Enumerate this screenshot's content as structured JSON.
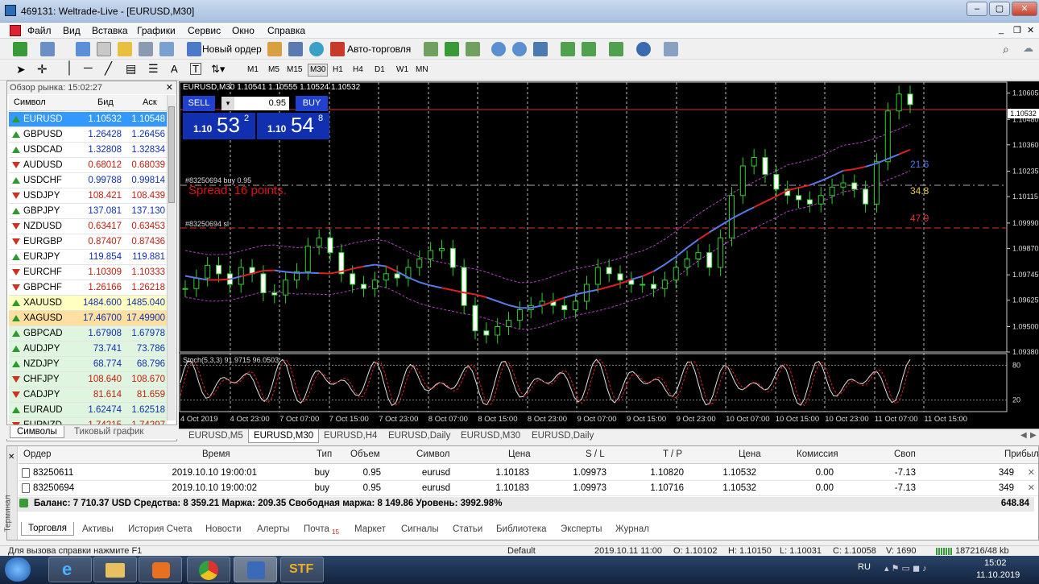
{
  "window": {
    "title": "469131: Weltrade-Live - [EURUSD,M30]"
  },
  "menu": [
    "Файл",
    "Вид",
    "Вставка",
    "Графики",
    "Сервис",
    "Окно",
    "Справка"
  ],
  "toolbar": {
    "new_order": "Новый ордер",
    "autotrading": "Авто-торговля"
  },
  "timeframes": [
    "M1",
    "M5",
    "M15",
    "M30",
    "H1",
    "H4",
    "D1",
    "W1",
    "MN"
  ],
  "active_timeframe": "M30",
  "market_watch": {
    "header": "Обзор рынка: 15:02:27",
    "col_symbol": "Символ",
    "col_bid": "Бид",
    "col_ask": "Аск",
    "rows": [
      {
        "symbol": "EURUSD",
        "bid": "1.10532",
        "ask": "1.10548",
        "dir": "up",
        "selected": true
      },
      {
        "symbol": "GBPUSD",
        "bid": "1.26428",
        "ask": "1.26456",
        "dir": "up"
      },
      {
        "symbol": "USDCAD",
        "bid": "1.32808",
        "ask": "1.32834",
        "dir": "up"
      },
      {
        "symbol": "AUDUSD",
        "bid": "0.68012",
        "ask": "0.68039",
        "dir": "down"
      },
      {
        "symbol": "USDCHF",
        "bid": "0.99788",
        "ask": "0.99814",
        "dir": "up"
      },
      {
        "symbol": "USDJPY",
        "bid": "108.421",
        "ask": "108.439",
        "dir": "down"
      },
      {
        "symbol": "GBPJPY",
        "bid": "137.081",
        "ask": "137.130",
        "dir": "up"
      },
      {
        "symbol": "NZDUSD",
        "bid": "0.63417",
        "ask": "0.63453",
        "dir": "down"
      },
      {
        "symbol": "EURGBP",
        "bid": "0.87407",
        "ask": "0.87436",
        "dir": "down"
      },
      {
        "symbol": "EURJPY",
        "bid": "119.854",
        "ask": "119.881",
        "dir": "up"
      },
      {
        "symbol": "EURCHF",
        "bid": "1.10309",
        "ask": "1.10333",
        "dir": "down"
      },
      {
        "symbol": "GBPCHF",
        "bid": "1.26166",
        "ask": "1.26218",
        "dir": "down"
      },
      {
        "symbol": "XAUUSD",
        "bid": "1484.600",
        "ask": "1485.040",
        "dir": "up",
        "highlight": "#ffffc0"
      },
      {
        "symbol": "XAGUSD",
        "bid": "17.46700",
        "ask": "17.49900",
        "dir": "up",
        "highlight": "#ffe0a0"
      },
      {
        "symbol": "GBPCAD",
        "bid": "1.67908",
        "ask": "1.67978",
        "dir": "up",
        "highlight": "#dff5df"
      },
      {
        "symbol": "AUDJPY",
        "bid": "73.741",
        "ask": "73.786",
        "dir": "up",
        "highlight": "#dff5df"
      },
      {
        "symbol": "NZDJPY",
        "bid": "68.774",
        "ask": "68.796",
        "dir": "up",
        "highlight": "#dff5df"
      },
      {
        "symbol": "CHFJPY",
        "bid": "108.640",
        "ask": "108.670",
        "dir": "down",
        "highlight": "#dff5df"
      },
      {
        "symbol": "CADJPY",
        "bid": "81.614",
        "ask": "81.659",
        "dir": "down",
        "highlight": "#dff5df"
      },
      {
        "symbol": "EURAUD",
        "bid": "1.62474",
        "ask": "1.62518",
        "dir": "up",
        "highlight": "#dff5df"
      },
      {
        "symbol": "EURNZD",
        "bid": "1.74215",
        "ask": "1.74297",
        "dir": "down",
        "highlight": "#dff5df"
      }
    ],
    "tabs": [
      "Символы",
      "Тиковый график"
    ]
  },
  "chart": {
    "header": "EURUSD,M30  1.10541 1.10555 1.10524 1.10532",
    "sell": "SELL",
    "buy": "BUY",
    "lot": "0.95",
    "sell_prefix": "1.10",
    "sell_big": "53",
    "sell_sup": "2",
    "buy_prefix": "1.10",
    "buy_big": "54",
    "buy_sup": "8",
    "order_buy_label": "#83250694 buy 0.95",
    "order_sl_label": "#83250694 sl",
    "spread": "Spread: 16 points.",
    "levels": {
      "a": "21.6",
      "b": "34.8",
      "c": "47.9"
    },
    "stoch_label": "Stoch(5,3,3) 91.9715 96.0503",
    "current_price": "1.10532"
  },
  "chart_data": {
    "type": "line",
    "title": "EURUSD,M30",
    "y_ticks": [
      "1.10605",
      "1.10480",
      "1.10360",
      "1.10235",
      "1.10115",
      "1.09990",
      "1.09870",
      "1.09745",
      "1.09625",
      "1.09500",
      "1.09380"
    ],
    "x_ticks": [
      "4 Oct 2019",
      "4 Oct 23:00",
      "7 Oct 07:00",
      "7 Oct 15:00",
      "7 Oct 23:00",
      "8 Oct 07:00",
      "8 Oct 15:00",
      "8 Oct 23:00",
      "9 Oct 07:00",
      "9 Oct 15:00",
      "9 Oct 23:00",
      "10 Oct 07:00",
      "10 Oct 15:00",
      "10 Oct 23:00",
      "11 Oct 07:00",
      "11 Oct 15:00"
    ],
    "ylim": [
      1.0938,
      1.1066
    ],
    "series": [
      {
        "values": [
          1.0968,
          1.0973,
          1.0979,
          1.0975,
          1.097,
          1.0978,
          1.0975,
          1.0966,
          1.0965,
          1.0972,
          1.0976,
          1.0988,
          1.0992,
          1.0985,
          1.0975,
          1.097,
          1.0968,
          1.0972,
          1.0975,
          1.0973,
          1.0978,
          1.0982,
          1.0986,
          1.0987,
          1.0978,
          1.096,
          1.0948,
          1.0946,
          1.095,
          1.0953,
          1.0958,
          1.096,
          1.0962,
          1.096,
          1.0958,
          1.0962,
          1.097,
          1.0978,
          1.0975,
          1.0972,
          1.097,
          1.097,
          1.0968,
          1.0972,
          1.0978,
          1.0982,
          1.0985,
          1.0978,
          1.0992,
          1.1012,
          1.1026,
          1.103,
          1.1022,
          1.1015,
          1.1012,
          1.101,
          1.1008,
          1.1012,
          1.1016,
          1.1018,
          1.1015,
          1.1008,
          1.1028,
          1.1052,
          1.106,
          1.1055
        ]
      }
    ],
    "stoch_levels": [
      "80",
      "20"
    ]
  },
  "terminal": {
    "headers": [
      "Ордер",
      "Время",
      "Тип",
      "Объем",
      "Символ",
      "Цена",
      "S / L",
      "T / P",
      "Цена",
      "Комиссия",
      "Своп",
      "Прибыль"
    ],
    "rows": [
      [
        "83250611",
        "2019.10.10 19:00:01",
        "buy",
        "0.95",
        "eurusd",
        "1.10183",
        "1.09973",
        "1.10820",
        "1.10532",
        "0.00",
        "-7.13",
        "349"
      ],
      [
        "83250694",
        "2019.10.10 19:00:02",
        "buy",
        "0.95",
        "eurusd",
        "1.10183",
        "1.09973",
        "1.10716",
        "1.10532",
        "0.00",
        "-7.13",
        "349"
      ]
    ],
    "balance": "Баланс: 7 710.37 USD  Средства: 8 359.21  Маржа: 209.35  Свободная маржа: 8 149.86  Уровень: 3992.98%",
    "total": "648.84",
    "side_label": "Терминал",
    "tabs": [
      "Торговля",
      "Активы",
      "История Счета",
      "Новости",
      "Алерты",
      "Почта",
      "Маркет",
      "Сигналы",
      "Статьи",
      "Библиотека",
      "Эксперты",
      "Журнал"
    ],
    "mail_count": "15"
  },
  "chart_tabs": [
    "EURUSD,M5",
    "EURUSD,M30",
    "EURUSD,H4",
    "EURUSD,Daily",
    "EURUSD,M30",
    "EURUSD,Daily"
  ],
  "status": {
    "help": "Для вызова справки нажмите F1",
    "profile": "Default",
    "time": "2019.10.11 11:00",
    "o": "O: 1.10102",
    "h": "H: 1.10150",
    "l": "L: 1.10031",
    "c": "C: 1.10058",
    "v": "V: 1690",
    "traffic": "187216/48 kb"
  },
  "taskbar": {
    "lang": "RU",
    "clock": "15:02",
    "date": "11.10.2019"
  }
}
